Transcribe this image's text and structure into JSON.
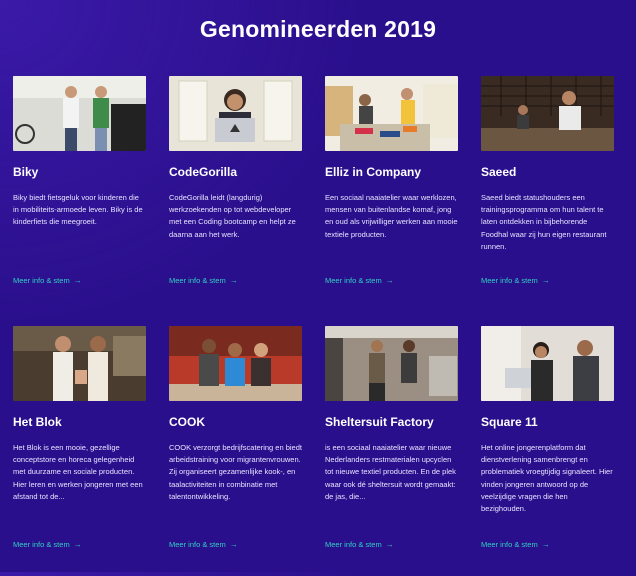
{
  "title": "Genomineerden 2019",
  "link_label": "Meer info & stem",
  "cards": [
    {
      "title": "Biky",
      "description": "Biky biedt fietsgeluk voor kinderen die in mobiliteits-armoede leven. Biky is de kinderfiets die meegroeit."
    },
    {
      "title": "CodeGorilla",
      "description": "CodeGorilla leidt (langdurig) werkzoekenden op tot webdeveloper met een Coding bootcamp en helpt ze daarna aan het werk."
    },
    {
      "title": "Elliz in Company",
      "description": "Een sociaal naaiatelier waar werklozen, mensen van buitenlandse komaf, jong en oud als vrijwilliger werken aan mooie textiele producten."
    },
    {
      "title": "Saeed",
      "description": "Saeed biedt statushouders een trainingsprogramma om hun talent te laten ontdekken in bijbehorende Foodhal waar zij hun eigen restaurant runnen."
    },
    {
      "title": "Het Blok",
      "description": "Het Blok is een mooie, gezellige conceptstore en horeca gelegenheid met duurzame en sociale producten. Hier leren en werken jongeren met een afstand tot de..."
    },
    {
      "title": "COOK",
      "description": "COOK verzorgt bedrijfscatering en biedt arbeidstraining voor migrantenvrouwen. Zij organiseert gezamenlijke kook-, en taalactiviteiten in combinatie met talentontwikkeling."
    },
    {
      "title": "Sheltersuit Factory",
      "description": "is een sociaal naaiatelier waar nieuwe Nederlanders restmaterialen upcyclen tot nieuwe textiel producten. En de plek waar ook dé sheltersuit wordt gemaakt: de jas, die..."
    },
    {
      "title": "Square 11",
      "description": "Het online jongerenplatform dat dienstverlening samenbrengt en problematiek vroegtijdig signaleert. Hier vinden jongeren antwoord op de veelzijdige vragen die hen bezighouden."
    }
  ],
  "colors": {
    "background": "#2a0f8c",
    "accent": "#2fd1c4"
  }
}
